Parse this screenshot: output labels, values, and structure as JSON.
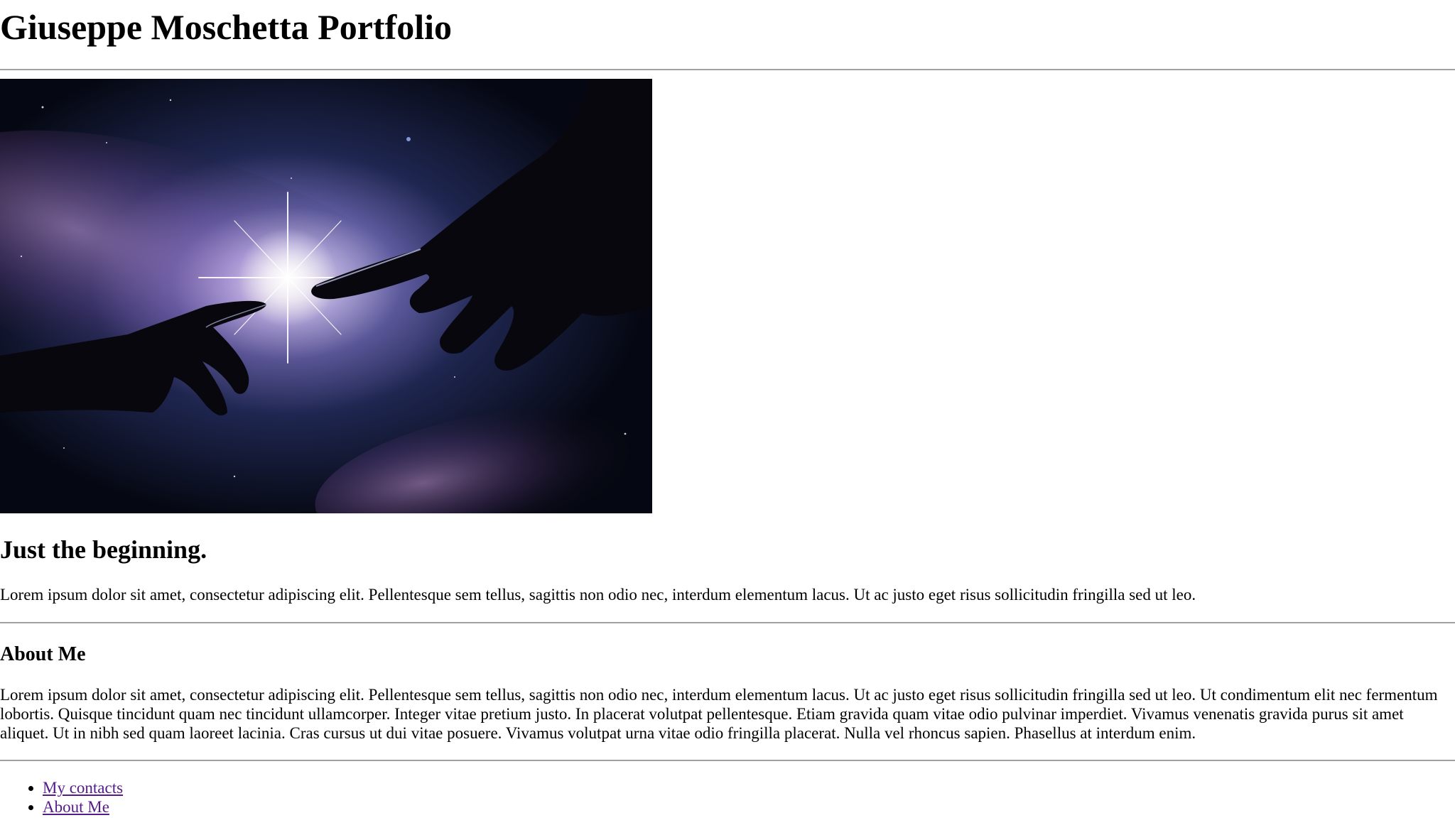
{
  "header": {
    "title": "Giuseppe Moschetta Portfolio"
  },
  "hero": {
    "image_icon": "hands-reaching-toward-light-in-galaxy-image"
  },
  "intro": {
    "heading": "Just the beginning.",
    "text": "Lorem ipsum dolor sit amet, consectetur adipiscing elit. Pellentesque sem tellus, sagittis non odio nec, interdum elementum lacus. Ut ac justo eget risus sollicitudin fringilla sed ut leo."
  },
  "about": {
    "heading": "About Me",
    "text": "Lorem ipsum dolor sit amet, consectetur adipiscing elit. Pellentesque sem tellus, sagittis non odio nec, interdum elementum lacus. Ut ac justo eget risus sollicitudin fringilla sed ut leo. Ut condimentum elit nec fermentum lobortis. Quisque tincidunt quam nec tincidunt ullamcorper. Integer vitae pretium justo. In placerat volutpat pellentesque. Etiam gravida quam vitae odio pulvinar imperdiet. Vivamus venenatis gravida purus sit amet aliquet. Ut in nibh sed quam laoreet lacinia. Cras cursus ut dui vitae posuere. Vivamus volutpat urna vitae odio fringilla placerat. Nulla vel rhoncus sapien. Phasellus at interdum enim."
  },
  "nav": {
    "links": [
      {
        "label": "My contacts"
      },
      {
        "label": "About Me"
      }
    ]
  },
  "colors": {
    "link_visited": "#551a8b",
    "rule": "#a0a0a0"
  }
}
